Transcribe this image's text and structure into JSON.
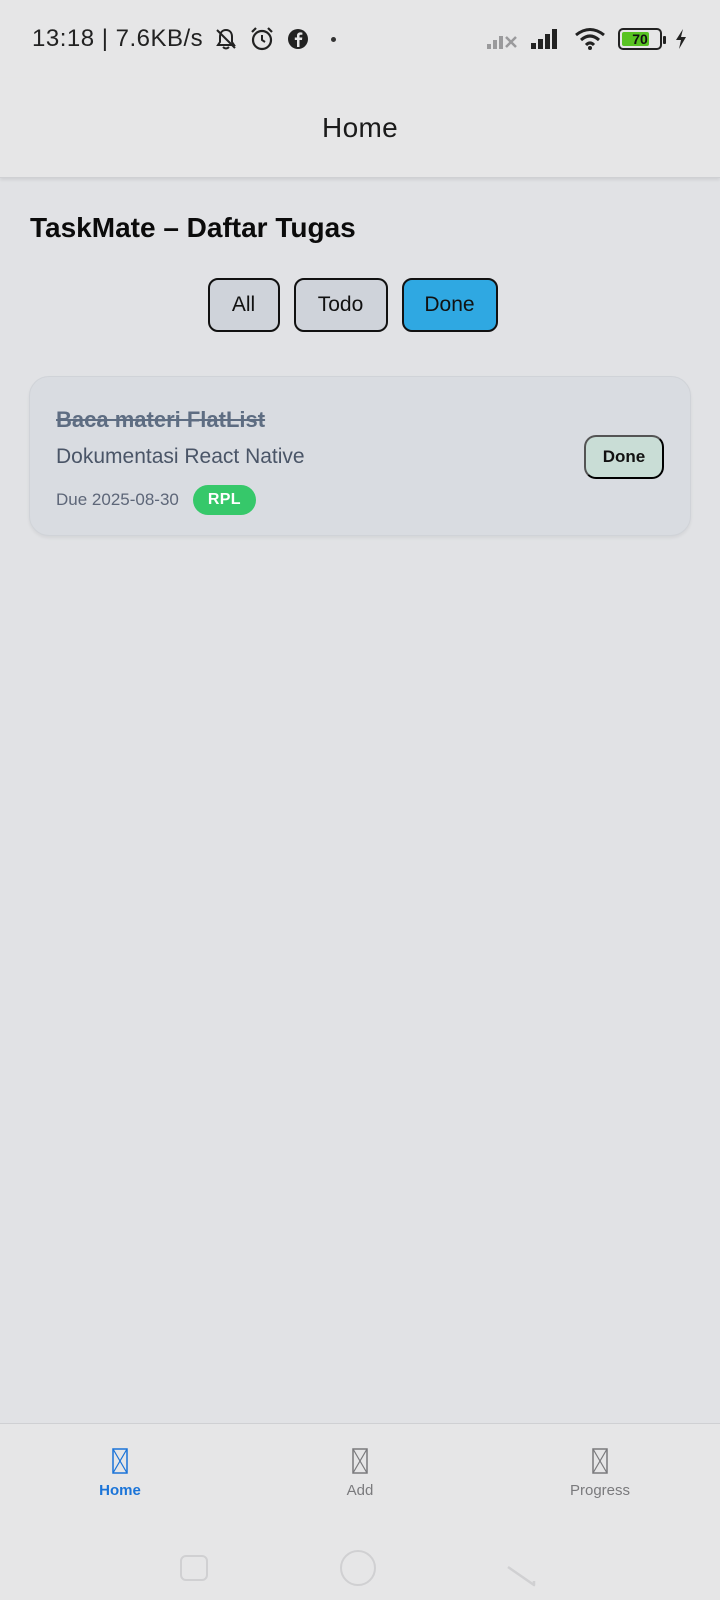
{
  "status_bar": {
    "time_speed": "13:18 | 7.6KB/s",
    "battery": "70",
    "icons": [
      "bell-off-icon",
      "alarm-icon",
      "facebook-icon",
      "signal-off-icon",
      "signal-icon",
      "wifi-icon",
      "battery-icon",
      "charging-icon"
    ]
  },
  "header": {
    "title": "Home"
  },
  "page": {
    "heading": "TaskMate – Daftar Tugas"
  },
  "filters": {
    "all": "All",
    "todo": "Todo",
    "done": "Done",
    "active": "done",
    "active_color": "#2fa8e2"
  },
  "task": {
    "title": "Baca materi FlatList",
    "description": "Dokumentasi React Native",
    "due": "Due 2025-08-30",
    "tag": "RPL",
    "tag_color": "#36c86a",
    "status": "Done"
  },
  "tabbar": {
    "home": "Home",
    "add": "Add",
    "progress": "Progress",
    "active": "home",
    "active_color": "#1b74d8"
  }
}
